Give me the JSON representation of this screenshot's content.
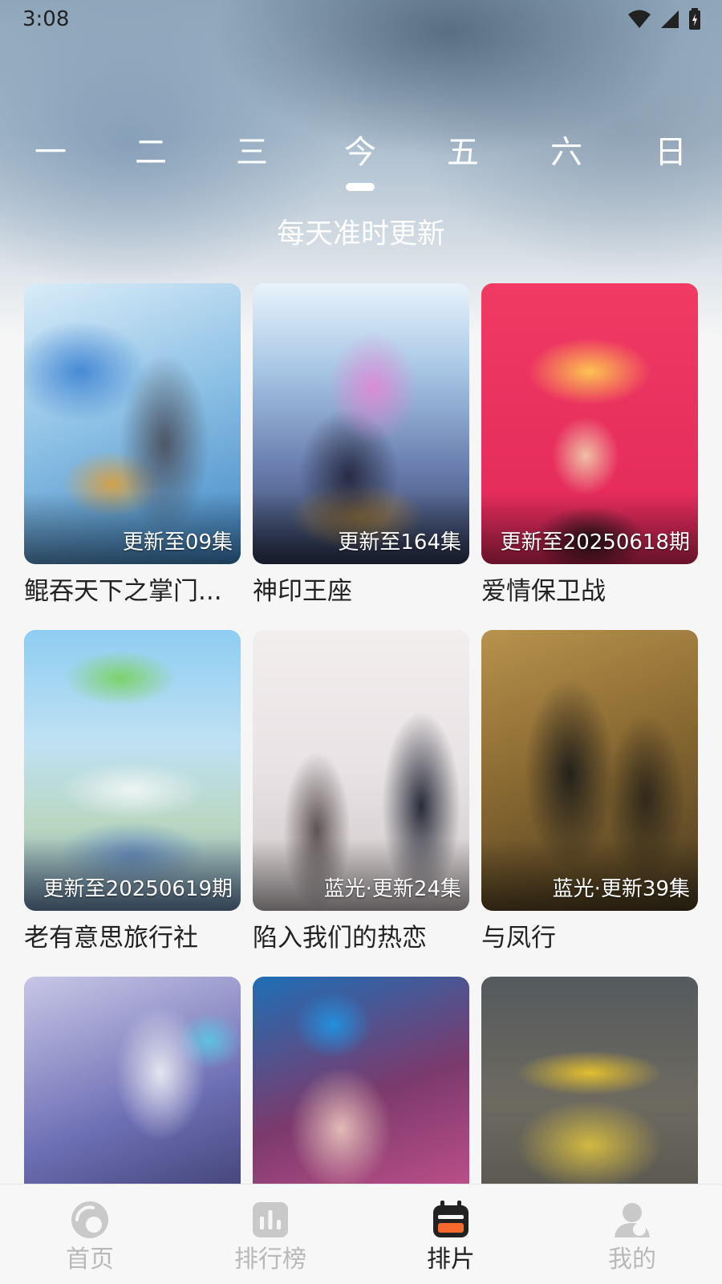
{
  "status_bar": {
    "time": "3:08",
    "icons": [
      "wifi-icon",
      "cellular-signal-icon",
      "battery-icon"
    ]
  },
  "week_tabs": {
    "items": [
      {
        "label": "一",
        "selected": false
      },
      {
        "label": "二",
        "selected": false
      },
      {
        "label": "三",
        "selected": false
      },
      {
        "label": "今",
        "selected": true
      },
      {
        "label": "五",
        "selected": false
      },
      {
        "label": "六",
        "selected": false
      },
      {
        "label": "日",
        "selected": false
      }
    ]
  },
  "subtitle": "每天准时更新",
  "shows": [
    {
      "title": "鲲吞天下之掌门...",
      "badge": "更新至09集"
    },
    {
      "title": "神印王座",
      "badge": "更新至164集"
    },
    {
      "title": "爱情保卫战",
      "badge": "更新至20250618期"
    },
    {
      "title": "老有意思旅行社",
      "badge": "更新至20250619期"
    },
    {
      "title": "陷入我们的热恋",
      "badge": "蓝光·更新24集"
    },
    {
      "title": "与凤行",
      "badge": "蓝光·更新39集"
    },
    {
      "title": "",
      "badge": ""
    },
    {
      "title": "",
      "badge": ""
    },
    {
      "title": "",
      "badge": ""
    }
  ],
  "bottom_nav": {
    "items": [
      {
        "label": "首页",
        "icon": "home-icon",
        "active": false
      },
      {
        "label": "排行榜",
        "icon": "ranking-icon",
        "active": false
      },
      {
        "label": "排片",
        "icon": "schedule-icon",
        "active": true
      },
      {
        "label": "我的",
        "icon": "profile-icon",
        "active": false
      }
    ]
  },
  "colors": {
    "active_nav": "#222222",
    "inactive_nav": "#b9b9b9",
    "schedule_icon_accent": "#f56a2c"
  }
}
